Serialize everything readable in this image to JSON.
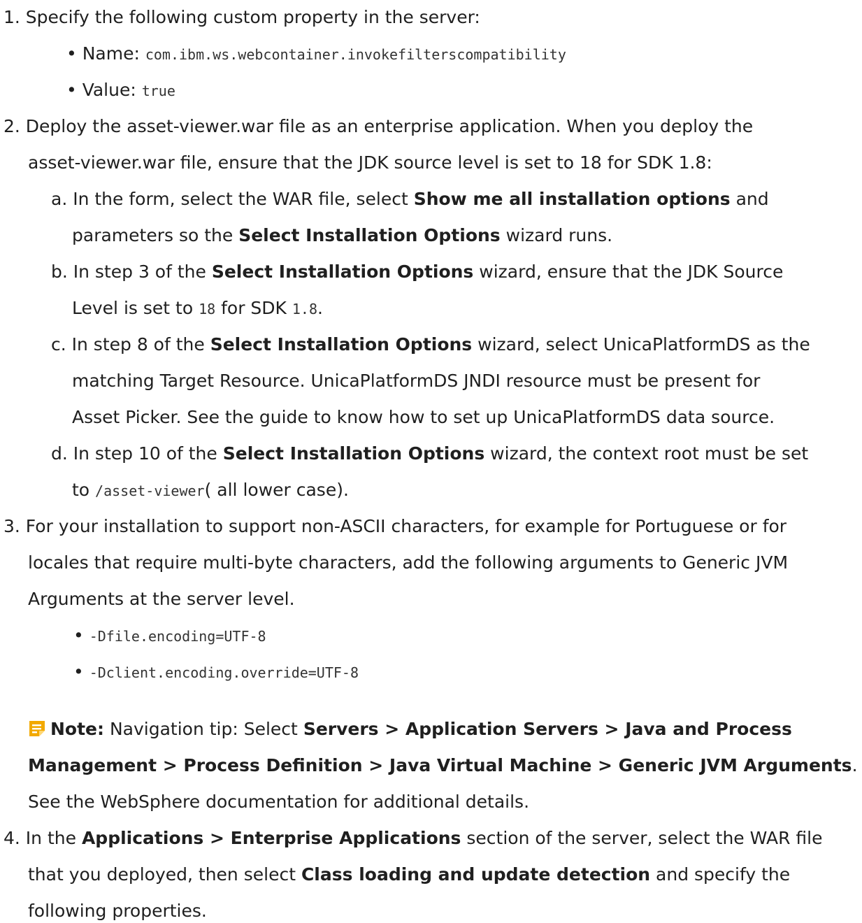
{
  "step1": {
    "text": "1. Specify the following custom property in the server:",
    "name_label": "• Name: ",
    "name_value": "com.ibm.ws.webcontainer.invokefilterscompatibility",
    "value_label": "• Value: ",
    "value_value": "true"
  },
  "step2": {
    "line1": "2. Deploy the asset-viewer.war file as an enterprise application. When you deploy the",
    "line2": "asset-viewer.war file, ensure that the JDK source level is set to 18 for SDK 1.8:",
    "a": {
      "p1": "a. In the form, select the WAR file, select ",
      "b1": "Show me all installation options",
      "p2": " and",
      "p3": "parameters so the ",
      "b2": "Select Installation Options",
      "p4": " wizard runs."
    },
    "b": {
      "p1": "b. In step 3 of the  ",
      "b1": "Select Installation Options",
      "p2": " wizard, ensure that the JDK Source",
      "p3": "Level is set to ",
      "c1": "18",
      "p4": " for SDK ",
      "c2": "1.8",
      "p5": "."
    },
    "c": {
      "p1": "c. In step 8 of the  ",
      "b1": "Select Installation Options",
      "p2": " wizard, select UnicaPlatformDS as the",
      "line2": "matching Target Resource. UnicaPlatformDS JNDI resource must be present for",
      "line3": "Asset Picker. See the guide to know how to set up UnicaPlatformDS data source."
    },
    "d": {
      "p1": "d. In step 10 of the  ",
      "b1": "Select Installation Options",
      "p2": " wizard, the context root must be set",
      "p3": "to ",
      "c1": "/asset-viewer",
      "p4": "( all lower case)."
    }
  },
  "step3": {
    "line1": "3. For your installation to support non-ASCII characters, for example for Portuguese or for",
    "line2": "locales that require multi-byte characters, add the following arguments to Generic JVM",
    "line3": "Arguments at the server level.",
    "bullet1": "-Dfile.encoding=UTF-8",
    "bullet2": "-Dclient.encoding.override=UTF-8",
    "note": {
      "icon": "note-icon",
      "label": "Note:",
      "p1": "  Navigation tip: Select ",
      "b1": "Servers > Application Servers > Java and Process",
      "b2": "Management > Process Definition > Java Virtual Machine > Generic JVM Arguments",
      "p2": ".",
      "line3": "See the WebSphere documentation for additional details."
    }
  },
  "step4": {
    "p1": "4. In the ",
    "b1": "Applications > Enterprise Applications",
    "p2": " section of the server, select the WAR file",
    "p3": "that you deployed, then select ",
    "b2": "Class loading and update detection",
    "p4": " and specify the",
    "line3": "following properties."
  },
  "colors": {
    "text": "#1f1f1f",
    "note_icon": "#f2a900"
  }
}
